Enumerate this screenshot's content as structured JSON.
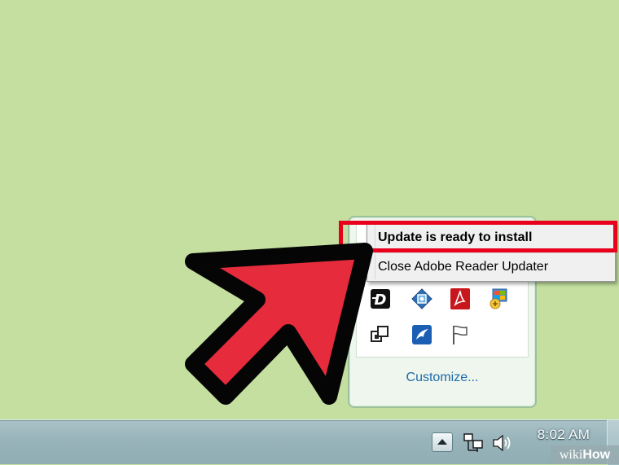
{
  "context_menu": {
    "items": [
      {
        "label": "Update is ready to install",
        "default": true
      },
      {
        "label": "Close Adobe Reader Updater",
        "default": false
      }
    ]
  },
  "tray_popup": {
    "icons": [
      {
        "name": "dynamic-d-icon"
      },
      {
        "name": "network-connector-icon"
      },
      {
        "name": "adobe-reader-icon"
      },
      {
        "name": "windows-update-icon"
      },
      {
        "name": "windows-switch-icon"
      },
      {
        "name": "swallow-app-icon"
      },
      {
        "name": "action-center-flag-icon"
      }
    ],
    "customize_label": "Customize..."
  },
  "taskbar": {
    "clock_time": "8:02 AM"
  },
  "watermark": {
    "wiki": "wiki",
    "how": "How"
  },
  "colors": {
    "desktop": "#c4dfa0",
    "highlight": "#e8001c",
    "pointer_fill": "#e52b3c",
    "link": "#1f6aa8"
  }
}
